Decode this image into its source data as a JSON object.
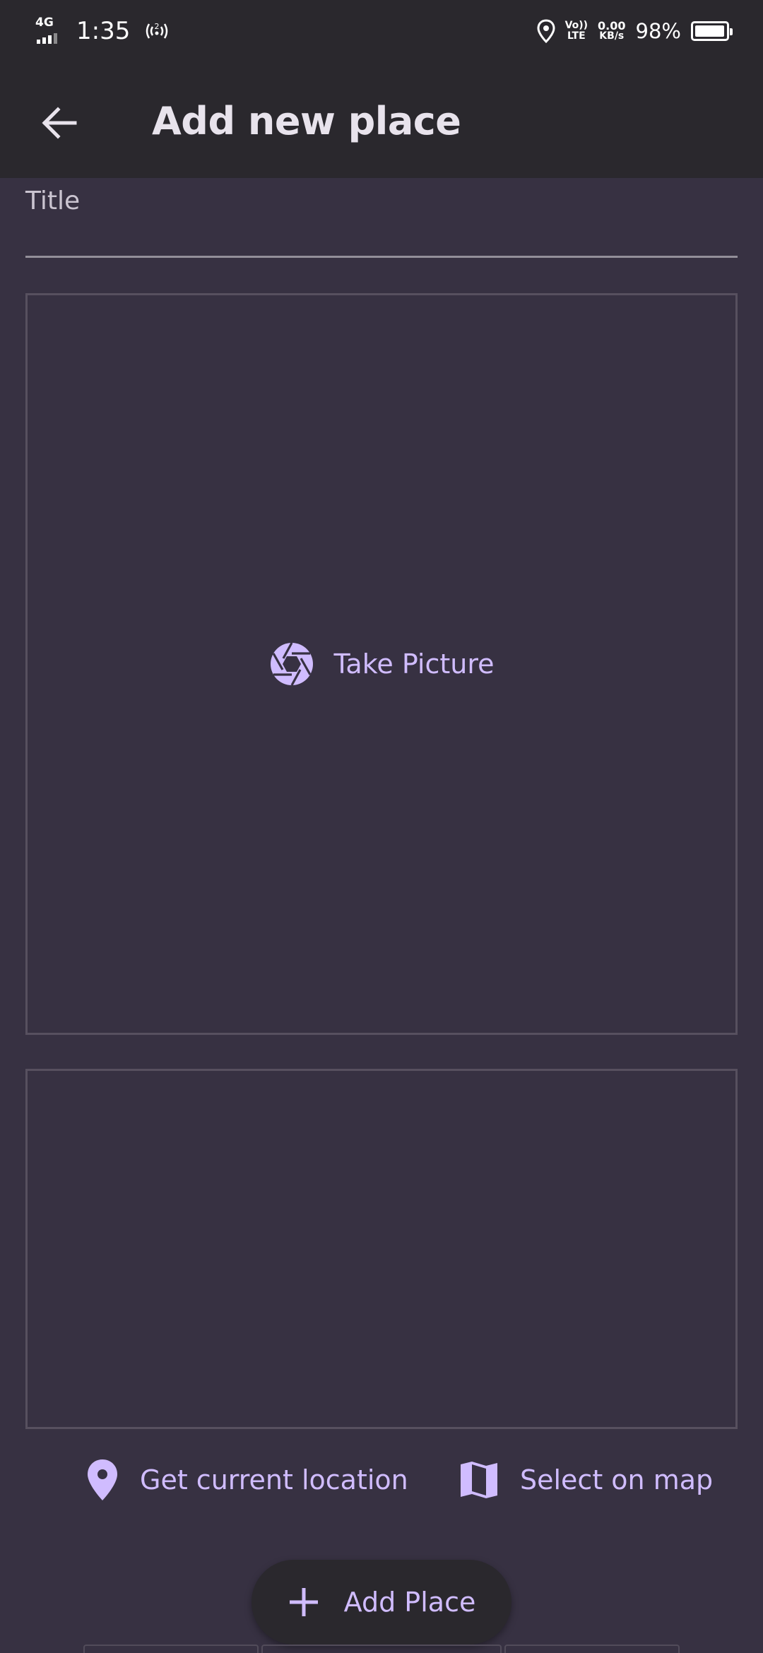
{
  "status_bar": {
    "network": "4G",
    "time": "1:35",
    "hotspot_count": "2",
    "volte_top": "Vo))",
    "volte_bottom": "LTE",
    "speed_value": "0.00",
    "speed_unit": "KB/s",
    "battery": "98%",
    "battery_level": 0.98
  },
  "app_bar": {
    "title": "Add new place",
    "back_icon": "arrow-back-icon"
  },
  "form": {
    "title_label": "Title",
    "title_value": ""
  },
  "image_picker": {
    "button_label": "Take Picture",
    "icon": "camera-aperture-icon"
  },
  "location": {
    "current_label": "Get current location",
    "current_icon": "location-pin-icon",
    "map_label": "Select on map",
    "map_icon": "map-icon"
  },
  "actions": {
    "add_label": "Add Place",
    "add_icon": "plus-icon"
  },
  "colors": {
    "background": "#373142",
    "app_bar": "#2a282d",
    "accent": "#d0bcff",
    "border": "#57505f"
  }
}
